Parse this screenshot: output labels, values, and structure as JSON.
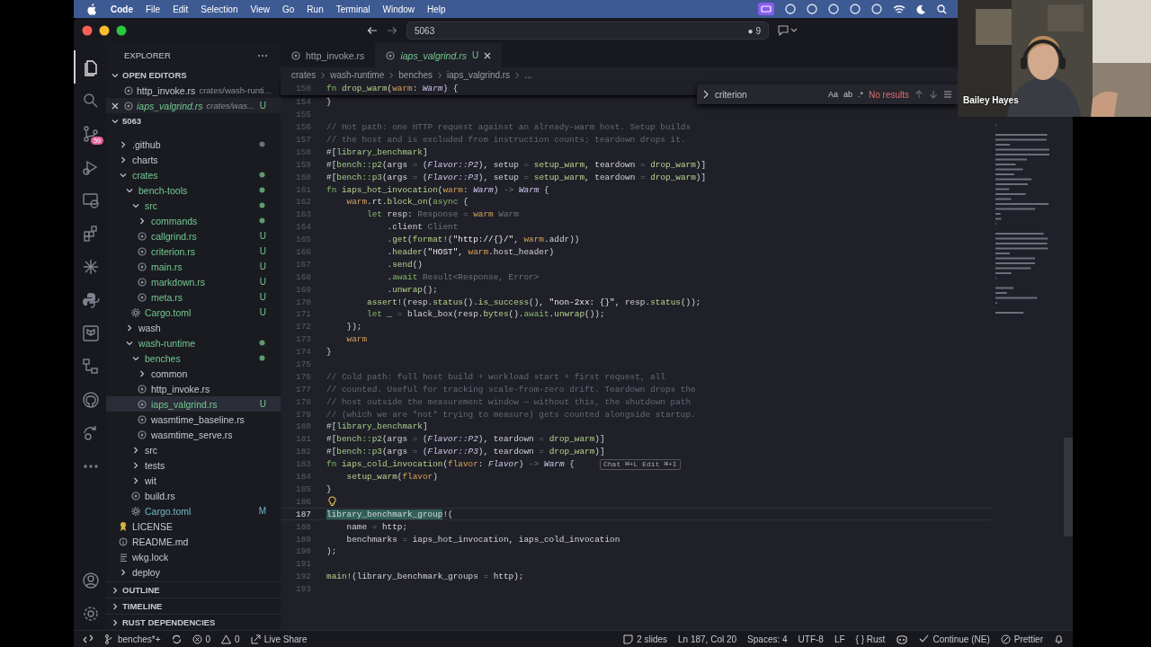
{
  "menubar": {
    "app": "Code",
    "items": [
      "File",
      "Edit",
      "Selection",
      "View",
      "Go",
      "Run",
      "Terminal",
      "Window",
      "Help"
    ]
  },
  "titlebar": {
    "search": "5063",
    "badge": "● 9"
  },
  "activity_bar": {
    "items": [
      {
        "kind": "files",
        "selected": true
      },
      {
        "kind": "search",
        "selected": false
      },
      {
        "kind": "scm",
        "badge": "59",
        "selected": false
      },
      {
        "kind": "debug",
        "selected": false
      },
      {
        "kind": "remote",
        "selected": false
      },
      {
        "kind": "extensions",
        "selected": false
      },
      {
        "kind": "sparkle",
        "selected": false
      },
      {
        "kind": "python",
        "selected": false
      },
      {
        "kind": "terraform",
        "selected": false
      },
      {
        "kind": "tree",
        "selected": false
      },
      {
        "kind": "github",
        "selected": false
      },
      {
        "kind": "liveshare",
        "selected": false
      },
      {
        "kind": "more",
        "selected": false
      }
    ],
    "bottom": [
      {
        "kind": "account"
      },
      {
        "kind": "settings"
      }
    ]
  },
  "sidebar": {
    "title": "EXPLORER",
    "open_editors": {
      "label": "OPEN EDITORS",
      "expanded": true,
      "items": [
        {
          "name": "http_invoke.rs",
          "path": "crates/wash-runti...",
          "untracked": false,
          "selected": false,
          "preview": false
        },
        {
          "name": "iaps_valgrind.rs",
          "path": "crates/was...",
          "badge": "U",
          "untracked": true,
          "selected": true,
          "preview": true
        }
      ]
    },
    "folder": {
      "label": "5063",
      "expanded": true,
      "children": [
        {
          "name": ".github",
          "kind": "folder",
          "expanded": false,
          "untracked": false,
          "modified": false,
          "changed": true,
          "selected": false
        },
        {
          "name": "charts",
          "kind": "folder",
          "expanded": false,
          "untracked": false,
          "modified": false,
          "changed": false,
          "selected": false
        },
        {
          "name": "crates",
          "kind": "folder",
          "expanded": true,
          "untracked": true,
          "modified": false,
          "changed": true,
          "selected": false,
          "children": [
            {
              "name": "bench-tools",
              "kind": "folder",
              "expanded": true,
              "untracked": true,
              "modified": false,
              "changed": true,
              "selected": false,
              "children": [
                {
                  "name": "src",
                  "kind": "folder",
                  "expanded": true,
                  "untracked": true,
                  "modified": false,
                  "changed": true,
                  "selected": false,
                  "children": [
                    {
                      "name": "commands",
                      "kind": "folder",
                      "expanded": false,
                      "untracked": true,
                      "modified": false,
                      "changed": true,
                      "selected": false
                    },
                    {
                      "name": "callgrind.rs",
                      "kind": "rust",
                      "badge": "U",
                      "untracked": true,
                      "modified": false,
                      "selected": false
                    },
                    {
                      "name": "criterion.rs",
                      "kind": "rust",
                      "badge": "U",
                      "untracked": true,
                      "modified": false,
                      "selected": false
                    },
                    {
                      "name": "main.rs",
                      "kind": "rust",
                      "badge": "U",
                      "untracked": true,
                      "modified": false,
                      "selected": false
                    },
                    {
                      "name": "markdown.rs",
                      "kind": "rust",
                      "badge": "U",
                      "untracked": true,
                      "modified": false,
                      "selected": false
                    },
                    {
                      "name": "meta.rs",
                      "kind": "rust",
                      "badge": "U",
                      "untracked": true,
                      "modified": false,
                      "selected": false
                    }
                  ]
                },
                {
                  "name": "Cargo.toml",
                  "kind": "gear",
                  "badge": "U",
                  "untracked": true,
                  "modified": false,
                  "selected": false
                }
              ]
            },
            {
              "name": "wash",
              "kind": "folder",
              "expanded": false,
              "untracked": false,
              "modified": false,
              "changed": false,
              "selected": false
            },
            {
              "name": "wash-runtime",
              "kind": "folder",
              "expanded": true,
              "untracked": true,
              "modified": false,
              "changed": true,
              "selected": false,
              "children": [
                {
                  "name": "benches",
                  "kind": "folder",
                  "expanded": true,
                  "untracked": true,
                  "modified": false,
                  "changed": true,
                  "selected": false,
                  "children": [
                    {
                      "name": "common",
                      "kind": "folder",
                      "expanded": false,
                      "untracked": false,
                      "modified": false,
                      "changed": false,
                      "selected": false
                    },
                    {
                      "name": "http_invoke.rs",
                      "kind": "rust",
                      "untracked": false,
                      "modified": false,
                      "selected": false
                    },
                    {
                      "name": "iaps_valgrind.rs",
                      "kind": "rust",
                      "badge": "U",
                      "untracked": true,
                      "modified": false,
                      "selected": true
                    },
                    {
                      "name": "wasmtime_baseline.rs",
                      "kind": "rust",
                      "untracked": false,
                      "modified": false,
                      "selected": false
                    },
                    {
                      "name": "wasmtime_serve.rs",
                      "kind": "rust",
                      "untracked": false,
                      "modified": false,
                      "selected": false
                    }
                  ]
                },
                {
                  "name": "src",
                  "kind": "folder",
                  "expanded": false,
                  "untracked": false,
                  "modified": false,
                  "changed": false,
                  "selected": false
                },
                {
                  "name": "tests",
                  "kind": "folder",
                  "expanded": false,
                  "untracked": false,
                  "modified": false,
                  "changed": false,
                  "selected": false
                },
                {
                  "name": "wit",
                  "kind": "folder",
                  "expanded": false,
                  "untracked": false,
                  "modified": false,
                  "changed": false,
                  "selected": false
                },
                {
                  "name": "build.rs",
                  "kind": "rust",
                  "untracked": false,
                  "modified": false,
                  "selected": false
                },
                {
                  "name": "Cargo.toml",
                  "kind": "gear",
                  "badge": "M",
                  "untracked": false,
                  "modified": true,
                  "selected": false
                }
              ]
            }
          ]
        },
        {
          "name": "LICENSE",
          "kind": "license",
          "untracked": false,
          "modified": false,
          "selected": false
        },
        {
          "name": "README.md",
          "kind": "info",
          "untracked": false,
          "modified": false,
          "selected": false
        },
        {
          "name": "wkg.lock",
          "kind": "lines",
          "untracked": false,
          "modified": false,
          "selected": false
        },
        {
          "name": "deploy",
          "kind": "folder",
          "expanded": false,
          "untracked": false,
          "modified": false,
          "changed": false,
          "selected": false
        }
      ]
    },
    "sections": [
      {
        "label": "OUTLINE",
        "expanded": false
      },
      {
        "label": "TIMELINE",
        "expanded": false
      },
      {
        "label": "RUST DEPENDENCIES",
        "expanded": false
      }
    ]
  },
  "tabs": [
    {
      "name": "http_invoke.rs",
      "untracked": false,
      "selected": false,
      "preview": false
    },
    {
      "name": "iaps_valgrind.rs",
      "badge": "U",
      "untracked": true,
      "selected": true,
      "preview": true
    }
  ],
  "breadcrumbs": [
    "crates",
    "wash-runtime",
    "benches",
    "iaps_valgrind.rs",
    "..."
  ],
  "find": {
    "value": "criterion",
    "options": [
      "Aa",
      "ab",
      ".*"
    ],
    "result": "No results"
  },
  "editor": {
    "sticky": {
      "number": "150",
      "segments": [
        {
          "kind": "kw",
          "text": "fn "
        },
        {
          "kind": "fn",
          "text": "drop_warm"
        },
        {
          "kind": "plain",
          "text": "("
        },
        {
          "kind": "param",
          "text": "warm"
        },
        {
          "kind": "plain",
          "text": ": "
        },
        {
          "kind": "type",
          "text": "Warm"
        },
        {
          "kind": "plain",
          "text": ") {"
        }
      ]
    },
    "lines": [
      {
        "number": "154",
        "segments": [
          {
            "kind": "plain",
            "text": "}"
          }
        ]
      },
      {
        "number": "155"
      },
      {
        "number": "156",
        "segments": [
          {
            "kind": "comment",
            "text": "// Hot path: one HTTP request against an already-warm host. Setup builds"
          }
        ]
      },
      {
        "number": "157",
        "segments": [
          {
            "kind": "comment",
            "text": "// the host and is excluded from instruction counts; teardown drops it."
          }
        ]
      },
      {
        "number": "158",
        "segments": [
          {
            "kind": "plain",
            "text": "#["
          },
          {
            "kind": "attr",
            "text": "library_benchmark"
          },
          {
            "kind": "plain",
            "text": "]"
          }
        ]
      },
      {
        "number": "159",
        "segments": [
          {
            "kind": "plain",
            "text": "#["
          },
          {
            "kind": "attr",
            "text": "bench::p2"
          },
          {
            "kind": "plain",
            "text": "(args"
          },
          {
            "kind": "op",
            "text": " = "
          },
          {
            "kind": "plain",
            "text": "("
          },
          {
            "kind": "type",
            "text": "Flavor::P2"
          },
          {
            "kind": "plain",
            "text": "), setup"
          },
          {
            "kind": "op",
            "text": " = "
          },
          {
            "kind": "fn",
            "text": "setup_warm"
          },
          {
            "kind": "plain",
            "text": ", teardown"
          },
          {
            "kind": "op",
            "text": " = "
          },
          {
            "kind": "fn",
            "text": "drop_warm"
          },
          {
            "kind": "plain",
            "text": ")]"
          }
        ]
      },
      {
        "number": "160",
        "segments": [
          {
            "kind": "plain",
            "text": "#["
          },
          {
            "kind": "attr",
            "text": "bench::p3"
          },
          {
            "kind": "plain",
            "text": "(args"
          },
          {
            "kind": "op",
            "text": " = "
          },
          {
            "kind": "plain",
            "text": "("
          },
          {
            "kind": "type",
            "text": "Flavor::P3"
          },
          {
            "kind": "plain",
            "text": "), setup"
          },
          {
            "kind": "op",
            "text": " = "
          },
          {
            "kind": "fn",
            "text": "setup_warm"
          },
          {
            "kind": "plain",
            "text": ", teardown"
          },
          {
            "kind": "op",
            "text": " = "
          },
          {
            "kind": "fn",
            "text": "drop_warm"
          },
          {
            "kind": "plain",
            "text": ")]"
          }
        ]
      },
      {
        "number": "161",
        "segments": [
          {
            "kind": "kw",
            "text": "fn "
          },
          {
            "kind": "fn",
            "text": "iaps_hot_invocation"
          },
          {
            "kind": "plain",
            "text": "("
          },
          {
            "kind": "param",
            "text": "warm"
          },
          {
            "kind": "plain",
            "text": ": "
          },
          {
            "kind": "type",
            "text": "Warm"
          },
          {
            "kind": "plain",
            "text": ") "
          },
          {
            "kind": "op",
            "text": "-> "
          },
          {
            "kind": "type",
            "text": "Warm"
          },
          {
            "kind": "plain",
            "text": " {"
          }
        ]
      },
      {
        "number": "162",
        "segments": [
          {
            "kind": "param",
            "text": "    warm"
          },
          {
            "kind": "plain",
            "text": ".rt."
          },
          {
            "kind": "fn",
            "text": "block_on"
          },
          {
            "kind": "plain",
            "text": "("
          },
          {
            "kind": "kw",
            "text": "async"
          },
          {
            "kind": "plain",
            "text": " {"
          }
        ]
      },
      {
        "number": "163",
        "segments": [
          {
            "kind": "kw",
            "text": "        let"
          },
          {
            "kind": "plain",
            "text": " resp: "
          },
          {
            "kind": "hint",
            "text": "Response"
          },
          {
            "kind": "op",
            "text": " = "
          },
          {
            "kind": "param",
            "text": "warm"
          },
          {
            "kind": "hint",
            "text": " Warm"
          }
        ]
      },
      {
        "number": "164",
        "segments": [
          {
            "kind": "plain",
            "text": "            .client "
          },
          {
            "kind": "hint",
            "text": "Client"
          }
        ]
      },
      {
        "number": "165",
        "segments": [
          {
            "kind": "plain",
            "text": "            ."
          },
          {
            "kind": "fn",
            "text": "get"
          },
          {
            "kind": "plain",
            "text": "("
          },
          {
            "kind": "macro",
            "text": "format!"
          },
          {
            "kind": "plain",
            "text": "("
          },
          {
            "kind": "str",
            "text": "\"http://{}/\""
          },
          {
            "kind": "plain",
            "text": ", "
          },
          {
            "kind": "param",
            "text": "warm"
          },
          {
            "kind": "plain",
            "text": ".addr))"
          }
        ]
      },
      {
        "number": "166",
        "segments": [
          {
            "kind": "plain",
            "text": "            ."
          },
          {
            "kind": "fn",
            "text": "header"
          },
          {
            "kind": "plain",
            "text": "("
          },
          {
            "kind": "str",
            "text": "\"HOST\""
          },
          {
            "kind": "plain",
            "text": ", "
          },
          {
            "kind": "param",
            "text": "warm"
          },
          {
            "kind": "plain",
            "text": ".host_header)"
          }
        ]
      },
      {
        "number": "167",
        "segments": [
          {
            "kind": "plain",
            "text": "            ."
          },
          {
            "kind": "fn",
            "text": "send"
          },
          {
            "kind": "plain",
            "text": "()"
          }
        ]
      },
      {
        "number": "168",
        "segments": [
          {
            "kind": "plain",
            "text": "            ."
          },
          {
            "kind": "kw",
            "text": "await "
          },
          {
            "kind": "hint",
            "text": "Result<Response, Error>"
          }
        ]
      },
      {
        "number": "169",
        "segments": [
          {
            "kind": "plain",
            "text": "            ."
          },
          {
            "kind": "fn",
            "text": "unwrap"
          },
          {
            "kind": "plain",
            "text": "();"
          }
        ]
      },
      {
        "number": "170",
        "segments": [
          {
            "kind": "macro",
            "text": "        assert!"
          },
          {
            "kind": "plain",
            "text": "(resp."
          },
          {
            "kind": "fn",
            "text": "status"
          },
          {
            "kind": "plain",
            "text": "()."
          },
          {
            "kind": "fn",
            "text": "is_success"
          },
          {
            "kind": "plain",
            "text": "(), "
          },
          {
            "kind": "str",
            "text": "\"non-2xx: {}\""
          },
          {
            "kind": "plain",
            "text": ", resp."
          },
          {
            "kind": "fn",
            "text": "status"
          },
          {
            "kind": "plain",
            "text": "());"
          }
        ]
      },
      {
        "number": "171",
        "segments": [
          {
            "kind": "kw",
            "text": "        let"
          },
          {
            "kind": "plain",
            "text": " _"
          },
          {
            "kind": "op",
            "text": " = "
          },
          {
            "kind": "plain",
            "text": "black_box(resp."
          },
          {
            "kind": "fn",
            "text": "bytes"
          },
          {
            "kind": "plain",
            "text": "()."
          },
          {
            "kind": "kw",
            "text": "await"
          },
          {
            "kind": "plain",
            "text": "."
          },
          {
            "kind": "fn",
            "text": "unwrap"
          },
          {
            "kind": "plain",
            "text": "());"
          }
        ]
      },
      {
        "number": "172",
        "segments": [
          {
            "kind": "plain",
            "text": "    });"
          }
        ]
      },
      {
        "number": "173",
        "segments": [
          {
            "kind": "param",
            "text": "    warm"
          }
        ]
      },
      {
        "number": "174",
        "segments": [
          {
            "kind": "plain",
            "text": "}"
          }
        ]
      },
      {
        "number": "175"
      },
      {
        "number": "176",
        "segments": [
          {
            "kind": "comment",
            "text": "// Cold path: full host build + workload start + first request, all"
          }
        ]
      },
      {
        "number": "177",
        "segments": [
          {
            "kind": "comment",
            "text": "// counted. Useful for tracking scale-from-zero drift. Teardown drops the"
          }
        ]
      },
      {
        "number": "178",
        "segments": [
          {
            "kind": "comment",
            "text": "// host outside the measurement window — without this, the shutdown path"
          }
        ]
      },
      {
        "number": "179",
        "segments": [
          {
            "kind": "comment",
            "text": "// (which we are *not* trying to measure) gets counted alongside startup."
          }
        ]
      },
      {
        "number": "180",
        "segments": [
          {
            "kind": "plain",
            "text": "#["
          },
          {
            "kind": "attr",
            "text": "library_benchmark"
          },
          {
            "kind": "plain",
            "text": "]"
          }
        ]
      },
      {
        "number": "181",
        "segments": [
          {
            "kind": "plain",
            "text": "#["
          },
          {
            "kind": "attr",
            "text": "bench::p2"
          },
          {
            "kind": "plain",
            "text": "(args"
          },
          {
            "kind": "op",
            "text": " = "
          },
          {
            "kind": "plain",
            "text": "("
          },
          {
            "kind": "type",
            "text": "Flavor::P2"
          },
          {
            "kind": "plain",
            "text": "), teardown"
          },
          {
            "kind": "op",
            "text": " = "
          },
          {
            "kind": "fn",
            "text": "drop_warm"
          },
          {
            "kind": "plain",
            "text": ")]"
          }
        ]
      },
      {
        "number": "182",
        "segments": [
          {
            "kind": "plain",
            "text": "#["
          },
          {
            "kind": "attr",
            "text": "bench::p3"
          },
          {
            "kind": "plain",
            "text": "(args"
          },
          {
            "kind": "op",
            "text": " = "
          },
          {
            "kind": "plain",
            "text": "("
          },
          {
            "kind": "type",
            "text": "Flavor::P3"
          },
          {
            "kind": "plain",
            "text": "), teardown"
          },
          {
            "kind": "op",
            "text": " = "
          },
          {
            "kind": "fn",
            "text": "drop_warm"
          },
          {
            "kind": "plain",
            "text": ")]"
          }
        ]
      },
      {
        "number": "183",
        "segments": [
          {
            "kind": "kw",
            "text": "fn "
          },
          {
            "kind": "fn",
            "text": "iaps_cold_invocation"
          },
          {
            "kind": "plain",
            "text": "("
          },
          {
            "kind": "param",
            "text": "flavor"
          },
          {
            "kind": "plain",
            "text": ": "
          },
          {
            "kind": "type",
            "text": "Flavor"
          },
          {
            "kind": "plain",
            "text": ") "
          },
          {
            "kind": "op",
            "text": "-> "
          },
          {
            "kind": "type",
            "text": "Warm"
          },
          {
            "kind": "plain",
            "text": " {"
          }
        ],
        "ai_hint": "Chat ⌘+L Edit ⌘+I"
      },
      {
        "number": "184",
        "segments": [
          {
            "kind": "fn",
            "text": "    setup_warm"
          },
          {
            "kind": "plain",
            "text": "("
          },
          {
            "kind": "param",
            "text": "flavor"
          },
          {
            "kind": "plain",
            "text": ")"
          }
        ]
      },
      {
        "number": "185",
        "segments": [
          {
            "kind": "plain",
            "text": "}"
          }
        ]
      },
      {
        "number": "186",
        "lightbulb": true
      },
      {
        "number": "187",
        "current": true,
        "segments": [
          {
            "kind": "selected",
            "text": "library_benchmark_group"
          },
          {
            "kind": "plain",
            "text": "!("
          }
        ]
      },
      {
        "number": "188",
        "segments": [
          {
            "kind": "plain",
            "text": "    name"
          },
          {
            "kind": "op",
            "text": " = "
          },
          {
            "kind": "plain",
            "text": "http;"
          }
        ]
      },
      {
        "number": "189",
        "segments": [
          {
            "kind": "plain",
            "text": "    benchmarks"
          },
          {
            "kind": "op",
            "text": " = "
          },
          {
            "kind": "plain",
            "text": "iaps_hot_invocation, iaps_cold_invocation"
          }
        ]
      },
      {
        "number": "190",
        "segments": [
          {
            "kind": "plain",
            "text": ");"
          }
        ]
      },
      {
        "number": "191"
      },
      {
        "number": "192",
        "segments": [
          {
            "kind": "macro",
            "text": "main!"
          },
          {
            "kind": "plain",
            "text": "(library_benchmark_groups"
          },
          {
            "kind": "op",
            "text": " = "
          },
          {
            "kind": "plain",
            "text": "http);"
          }
        ]
      },
      {
        "number": "193"
      }
    ]
  },
  "status_bar": {
    "left": [
      {
        "kind": "remote"
      },
      {
        "kind": "branch",
        "text": "benches*+"
      },
      {
        "kind": "sync"
      },
      {
        "kind": "errors",
        "text": "0"
      },
      {
        "kind": "warnings",
        "text": "0"
      },
      {
        "kind": "liveshare",
        "text": "Live Share"
      }
    ],
    "right": [
      {
        "kind": "slides",
        "text": "2 slides"
      },
      {
        "kind": "plain",
        "text": "Ln 187, Col 20"
      },
      {
        "kind": "plain",
        "text": "Spaces: 4"
      },
      {
        "kind": "plain",
        "text": "UTF-8"
      },
      {
        "kind": "plain",
        "text": "LF"
      },
      {
        "kind": "plain",
        "text": "{ } Rust"
      },
      {
        "kind": "copilot"
      },
      {
        "kind": "check",
        "text": "Continue (NE)"
      },
      {
        "kind": "blocked",
        "text": "Prettier"
      },
      {
        "kind": "bell"
      }
    ]
  },
  "webcam": {
    "kind": "picture",
    "name": "Bailey Hayes"
  }
}
